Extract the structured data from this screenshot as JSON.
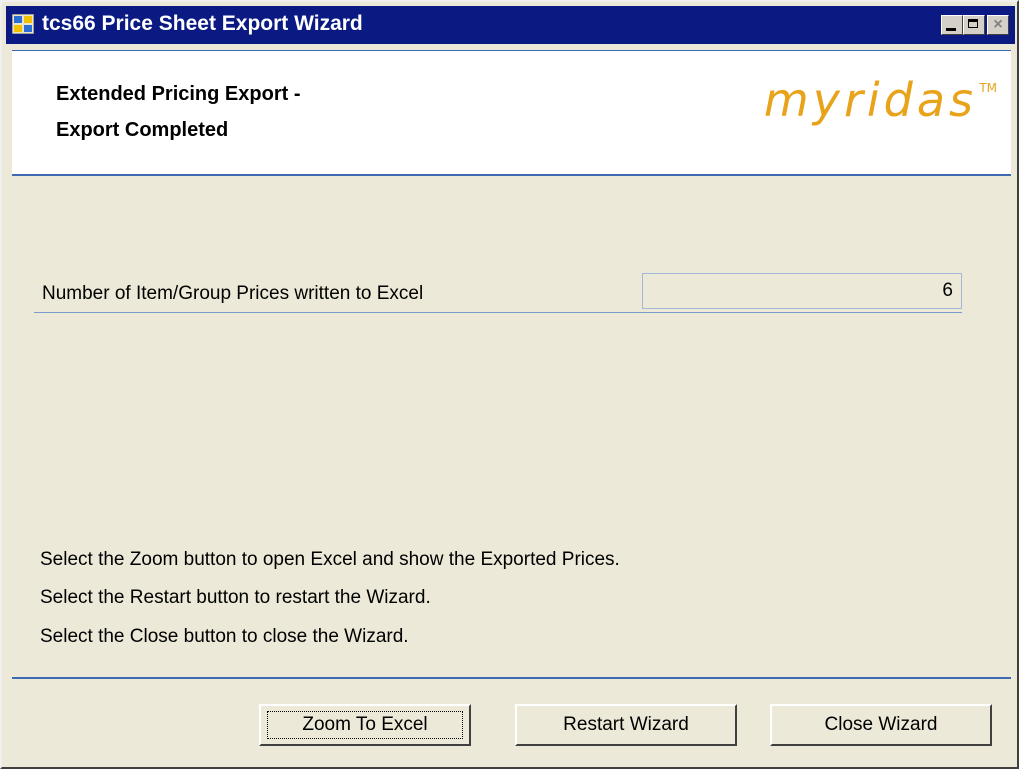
{
  "window": {
    "title": "tcs66 Price Sheet Export Wizard"
  },
  "header": {
    "line1": "Extended Pricing Export -",
    "line2": "Export Completed",
    "logo": "myridas",
    "logo_tm": "TM"
  },
  "main": {
    "count_label": "Number of Item/Group Prices written to Excel",
    "count_value": "6",
    "instructions": [
      "Select the Zoom button to open Excel and show the Exported Prices.",
      "Select the Restart button to restart the Wizard.",
      "Select the Close button to close the Wizard."
    ]
  },
  "buttons": {
    "zoom": "Zoom To Excel",
    "restart": "Restart Wizard",
    "close": "Close Wizard"
  },
  "colors": {
    "title_bar": "#0a1a82",
    "accent_line": "#3d6ab0",
    "logo": "#e8a31a",
    "dialog_bg": "#ece9d8"
  }
}
